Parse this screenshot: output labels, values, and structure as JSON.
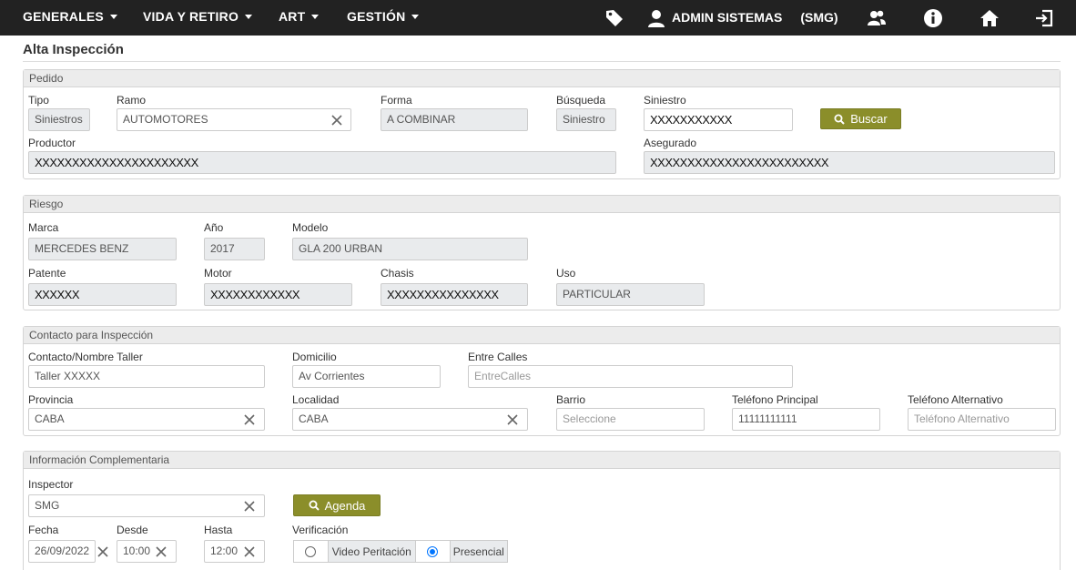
{
  "nav": {
    "menus": [
      "GENERALES",
      "VIDA Y RETIRO",
      "ART",
      "GESTIÓN"
    ],
    "user": "ADMIN SISTEMAS",
    "org": "(SMG)",
    "icons": [
      "tag-icon",
      "user-icon",
      "users-icon",
      "info-icon",
      "home-icon",
      "logout-icon"
    ]
  },
  "page_title": "Alta Inspección",
  "pedido": {
    "header": "Pedido",
    "tipo_label": "Tipo",
    "tipo_value": "Siniestros",
    "ramo_label": "Ramo",
    "ramo_value": "AUTOMOTORES",
    "forma_label": "Forma",
    "forma_value": "A COMBINAR",
    "busqueda_label": "Búsqueda",
    "busqueda_value": "Siniestro",
    "siniestro_label": "Siniestro",
    "siniestro_value": "XXXXXXXXXXX",
    "buscar_label": "Buscar",
    "productor_label": "Productor",
    "productor_value": "XXXXXXXXXXXXXXXXXXXXXX",
    "asegurado_label": "Asegurado",
    "asegurado_value": "XXXXXXXXXXXXXXXXXXXXXXXX"
  },
  "riesgo": {
    "header": "Riesgo",
    "marca_label": "Marca",
    "marca_value": "MERCEDES BENZ",
    "anio_label": "Año",
    "anio_value": "2017",
    "modelo_label": "Modelo",
    "modelo_value": "GLA 200  URBAN",
    "patente_label": "Patente",
    "patente_value": "XXXXXX",
    "motor_label": "Motor",
    "motor_value": "XXXXXXXXXXXX",
    "chasis_label": "Chasis",
    "chasis_value": "XXXXXXXXXXXXXXX",
    "uso_label": "Uso",
    "uso_value": "PARTICULAR"
  },
  "contacto": {
    "header": "Contacto para Inspección",
    "nombre_label": "Contacto/Nombre Taller",
    "nombre_value": "Taller XXXXX",
    "domicilio_label": "Domicilio",
    "domicilio_value": "Av Corrientes",
    "entre_label": "Entre Calles",
    "entre_placeholder": "EntreCalles",
    "provincia_label": "Provincia",
    "provincia_value": "CABA",
    "localidad_label": "Localidad",
    "localidad_value": "CABA",
    "barrio_label": "Barrio",
    "barrio_placeholder": "Seleccione",
    "tel_label": "Teléfono Principal",
    "tel_value": "11111111111",
    "tel_alt_label": "Teléfono Alternativo",
    "tel_alt_placeholder": "Teléfono Alternativo"
  },
  "info": {
    "header": "Información Complementaria",
    "inspector_label": "Inspector",
    "inspector_value": "SMG",
    "agenda_label": "Agenda",
    "fecha_label": "Fecha",
    "fecha_value": "26/09/2022",
    "desde_label": "Desde",
    "desde_value": "10:00",
    "hasta_label": "Hasta",
    "hasta_value": "12:00",
    "verificacion_label": "Verificación",
    "verificacion_options": [
      "Video Peritación",
      "Presencial"
    ],
    "verificacion_selected": "Presencial"
  },
  "colors": {
    "nav_bg": "#222222",
    "button": "#8b8e2a",
    "radio_selected": "#0075ff"
  }
}
